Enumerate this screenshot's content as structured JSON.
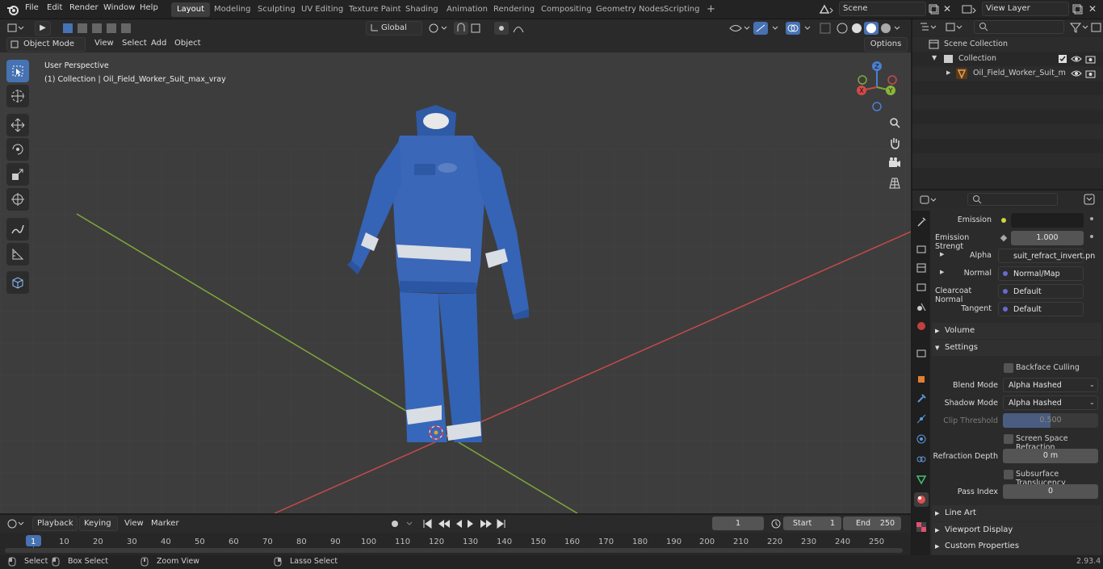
{
  "topbar": {
    "menu": [
      "File",
      "Edit",
      "Render",
      "Window",
      "Help"
    ],
    "workspaces": [
      "Layout",
      "Modeling",
      "Sculpting",
      "UV Editing",
      "Texture Paint",
      "Shading",
      "Animation",
      "Rendering",
      "Compositing",
      "Geometry Nodes",
      "Scripting"
    ],
    "active_workspace": "Layout",
    "scene": "Scene",
    "view_layer": "View Layer"
  },
  "viewport_header": {
    "mode": "Object Mode",
    "menus": [
      "View",
      "Select",
      "Add",
      "Object"
    ],
    "orientation": "Global",
    "options": "Options"
  },
  "viewport": {
    "perspective": "User Perspective",
    "collection_info": "(1) Collection | Oil_Field_Worker_Suit_max_vray",
    "axes": [
      "X",
      "Y",
      "Z"
    ]
  },
  "outliner": {
    "root": "Scene Collection",
    "collection": "Collection",
    "object": "Oil_Field_Worker_Suit_m"
  },
  "properties": {
    "emission_label": "Emission",
    "emission_strength_label": "Emission Strengt",
    "emission_strength": "1.000",
    "alpha_label": "Alpha",
    "alpha_value": "suit_refract_invert.pn",
    "normal_label": "Normal",
    "normal_value": "Normal/Map",
    "clearcoat_label": "Clearcoat Normal",
    "clearcoat_value": "Default",
    "tangent_label": "Tangent",
    "tangent_value": "Default",
    "volume": "Volume",
    "settings": "Settings",
    "backface": "Backface Culling",
    "blend_mode_label": "Blend Mode",
    "blend_mode": "Alpha Hashed",
    "shadow_mode_label": "Shadow Mode",
    "shadow_mode": "Alpha Hashed",
    "clip_label": "Clip Threshold",
    "clip_value": "0.500",
    "ssr": "Screen Space Refraction",
    "refraction_depth_label": "Refraction Depth",
    "refraction_depth": "0 m",
    "subsurface": "Subsurface Translucency",
    "pass_index_label": "Pass Index",
    "pass_index": "0",
    "line_art": "Line Art",
    "viewport_display": "Viewport Display",
    "custom_props": "Custom Properties"
  },
  "timeline": {
    "menus": [
      "Playback",
      "Keying",
      "View",
      "Marker"
    ],
    "current_frame": "1",
    "start_label": "Start",
    "start": "1",
    "end_label": "End",
    "end": "250",
    "ticks": [
      "1",
      "10",
      "20",
      "30",
      "40",
      "50",
      "60",
      "70",
      "80",
      "90",
      "100",
      "110",
      "120",
      "130",
      "140",
      "150",
      "160",
      "170",
      "180",
      "190",
      "200",
      "210",
      "220",
      "230",
      "240",
      "250"
    ]
  },
  "statusbar": {
    "select": "Select",
    "box_select": "Box Select",
    "zoom_view": "Zoom View",
    "lasso_select": "Lasso Select",
    "version": "2.93.4"
  },
  "colors": {
    "accent": "#4772b3",
    "suit": "#3a67b8",
    "x_axis": "#c64a4a",
    "y_axis": "#7fa83a"
  }
}
